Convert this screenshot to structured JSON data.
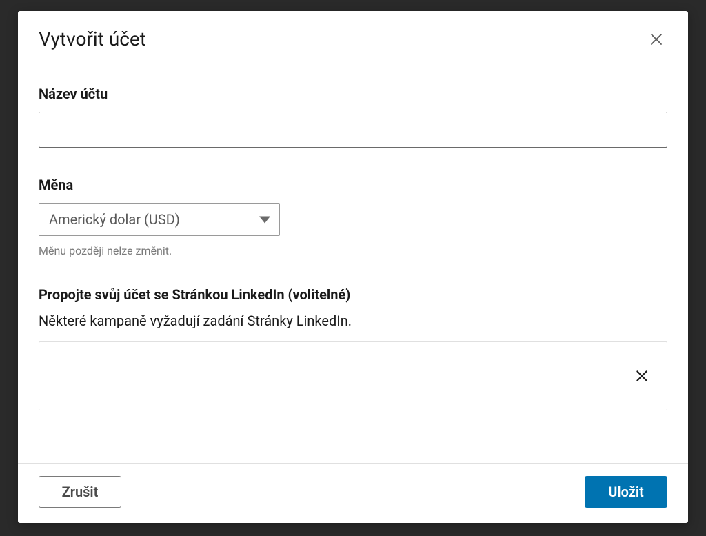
{
  "modal": {
    "title": "Vytvořit účet",
    "account_name": {
      "label": "Název účtu",
      "value": ""
    },
    "currency": {
      "label": "Měna",
      "selected": "Americký dolar (USD)",
      "helper": "Měnu později nelze změnit."
    },
    "link_page": {
      "label": "Propojte svůj účet se Stránkou LinkedIn (volitelné)",
      "description": "Některé kampaně vyžadují zadání Stránky LinkedIn."
    },
    "footer": {
      "cancel": "Zrušit",
      "save": "Uložit"
    }
  }
}
